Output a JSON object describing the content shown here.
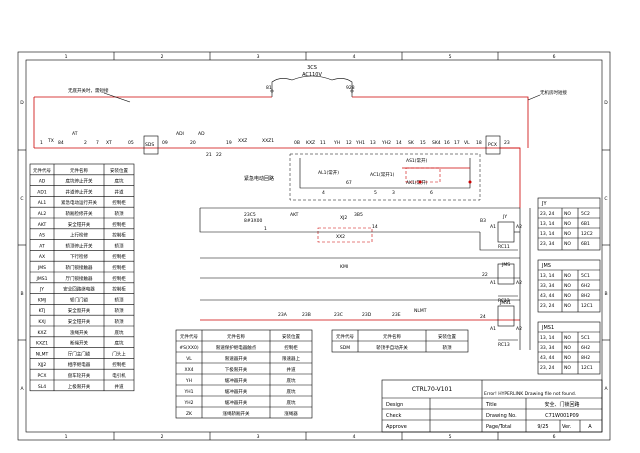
{
  "frame": {
    "top_numbers": [
      "1",
      "2",
      "3",
      "4",
      "5",
      "6"
    ],
    "bottom_numbers": [
      "1",
      "2",
      "3",
      "4",
      "5",
      "6"
    ],
    "left_letters": [
      "D",
      "C",
      "B",
      "A"
    ],
    "right_letters": [
      "D",
      "C",
      "B",
      "A"
    ]
  },
  "circuit": {
    "transformer": "3CS",
    "supply": "AC110V",
    "node_81": "81",
    "node_928": "928",
    "label_left": "无底开关时，需短接",
    "label_right": "无机房时短接",
    "top_chain": [
      "1",
      "TX",
      "84",
      "AT",
      "2",
      "7",
      "XT",
      "05",
      "SDS",
      "09",
      "ADI",
      "20",
      "AD",
      "21",
      "22",
      "19",
      "XXZ",
      "XXZ1",
      "0B",
      "KXZ",
      "11",
      "YH",
      "12",
      "YH1",
      "13",
      "YH2",
      "14",
      "SK",
      "15",
      "SK4",
      "16",
      "17",
      "VL",
      "18"
    ],
    "pcx": "PCX",
    "pcx_right": "23",
    "emergency_label": "紧急电动回路",
    "as1_label": "AS1(常开)",
    "al1_label": "AL1(常开)",
    "ac1_label": "AC1(常开1)",
    "ak1_label": "AK1(常开)",
    "nodes": [
      "67",
      "4",
      "5",
      "6",
      "3",
      "2",
      "1",
      "8"
    ],
    "row2": [
      "23C5",
      "8#3X00",
      "AKT",
      "XJ2",
      "3B5",
      "XX2",
      "14",
      "1",
      "1J",
      "1J1",
      "JY",
      "A1",
      "A2",
      "RC11",
      "B3"
    ],
    "kml": "KMI",
    "row3_nodes": [
      "22",
      "A1",
      "A2",
      "JMS",
      "RC12"
    ],
    "bottom_chain": [
      "23A",
      "23B",
      "23C",
      "23D",
      "23E",
      "NLMT",
      "24",
      "A1",
      "A2",
      "RC13",
      "JMS1"
    ]
  },
  "contact_tables": [
    {
      "title": "JY",
      "rows": [
        [
          "23, 24",
          "NO",
          "5C2"
        ],
        [
          "13, 14",
          "NO",
          "6B1"
        ],
        [
          "13, 14",
          "NO",
          "12C2"
        ],
        [
          "23, 34",
          "NO",
          "6B1"
        ]
      ]
    },
    {
      "title": "JMS",
      "rows": [
        [
          "13, 14",
          "NO",
          "5C1"
        ],
        [
          "33, 34",
          "NO",
          "6H2"
        ],
        [
          "43, 44",
          "NO",
          "8H2"
        ],
        [
          "23, 24",
          "NO",
          "12C1"
        ]
      ]
    },
    {
      "title": "JMS1",
      "rows": [
        [
          "13, 14",
          "NO",
          "5C1"
        ],
        [
          "33, 34",
          "NO",
          "6H2"
        ],
        [
          "43, 44",
          "NO",
          "8H2"
        ],
        [
          "23, 24",
          "NO",
          "12C1"
        ]
      ]
    }
  ],
  "component_table_left": {
    "headers": [
      "元件代号",
      "元件名称",
      "安装位置"
    ],
    "rows": [
      [
        "AD",
        "底坑停止开关",
        "底坑"
      ],
      [
        "AD1",
        "井道停止开关",
        "井道"
      ],
      [
        "AL1",
        "紧急电动运行开关",
        "控制柜"
      ],
      [
        "AL2",
        "轿厢检修开关",
        "轿顶"
      ],
      [
        "AKT",
        "安全钳开关",
        "控制柜"
      ],
      [
        "AS",
        "上行检修",
        "控制柜"
      ],
      [
        "AT",
        "轿顶停止开关",
        "轿顶"
      ],
      [
        "AX",
        "下行检修",
        "控制柜"
      ],
      [
        "JMS",
        "轿门锁接触器",
        "控制柜"
      ],
      [
        "JMS1",
        "厅门锁接触器",
        "控制柜"
      ],
      [
        "JY",
        "安全回路继电器",
        "控制柜"
      ],
      [
        "KMJ",
        "轿门门锁",
        "轿顶"
      ],
      [
        "KTJ",
        "安全窗开关",
        "轿顶"
      ],
      [
        "KXJ",
        "安全钳开关",
        "轿顶"
      ],
      [
        "KXZ",
        "涨绳开关",
        "底坑"
      ],
      [
        "KXZ1",
        "断绳开关",
        "底坑"
      ],
      [
        "NLMT",
        "厅门主门锁",
        "门头上"
      ],
      [
        "XJJ2",
        "相序继电器",
        "控制柜"
      ],
      [
        "PCX",
        "盘车轮开关",
        "电引机"
      ],
      [
        "SL4",
        "上极限开关",
        "井道"
      ]
    ]
  },
  "component_table_mid": {
    "headers": [
      "元件代号",
      "元件名称",
      "安装位置"
    ],
    "rows": [
      [
        "#S(XX0)",
        "限速保护继电器触点",
        "控制柜"
      ],
      [
        "VL",
        "限速器开关",
        "限速器上"
      ],
      [
        "XX4",
        "下极限开关",
        "井道"
      ],
      [
        "YH",
        "缓冲器开关",
        "底坑"
      ],
      [
        "YH1",
        "缓冲器开关",
        "底坑"
      ],
      [
        "YH2",
        "缓冲器开关",
        "底坑"
      ],
      [
        "ZK",
        "涨绳轿厢开关",
        "涨绳器"
      ]
    ]
  },
  "component_table_right": {
    "headers": [
      "元件代号",
      "元件名称",
      "安装位置"
    ],
    "rows": [
      [
        "SDM",
        "轿顶手自动开关",
        "轿顶"
      ]
    ]
  },
  "title_block": {
    "project": "CTRL70-V101",
    "error_text": "Error! HYPERLINK Drawing file not found.",
    "labels": [
      "Design",
      "Check",
      "Approve"
    ],
    "title_label": "Title",
    "title_value": "安全、门锁回路",
    "drawing_label": "Drawing No.",
    "drawing_value": "C71W001P09",
    "page_label": "Page/Total",
    "page_value": "9/25",
    "ver_label": "Ver.",
    "ver_value": "A"
  }
}
